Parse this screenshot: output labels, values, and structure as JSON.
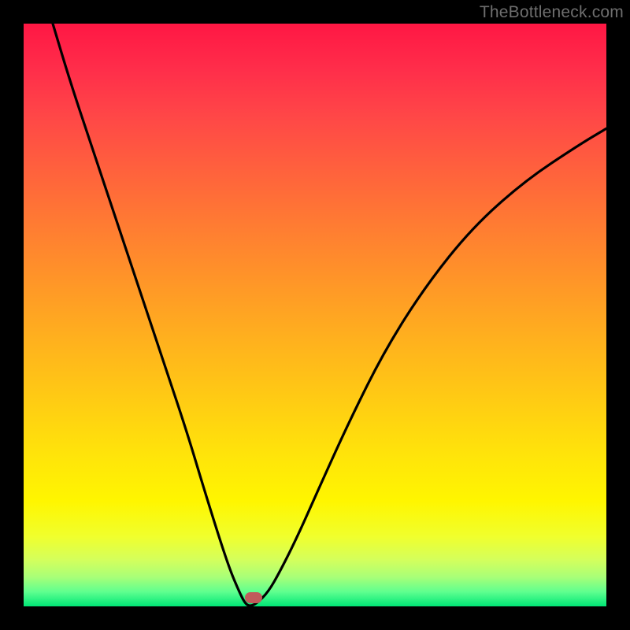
{
  "watermark": "TheBottleneck.com",
  "chart_data": {
    "type": "line",
    "title": "",
    "xlabel": "",
    "ylabel": "",
    "xlim": [
      0,
      100
    ],
    "ylim": [
      0,
      100
    ],
    "grid": false,
    "series": [
      {
        "name": "curve",
        "x": [
          5,
          8,
          12,
          16,
          20,
          24,
          28,
          31,
          33.5,
          35.5,
          37,
          38,
          38.8,
          40,
          42,
          44,
          47,
          51,
          56,
          62,
          69,
          77,
          86,
          95,
          100
        ],
        "y": [
          100,
          90,
          78,
          66,
          54,
          42,
          30,
          20,
          12,
          6,
          2.5,
          0.5,
          0,
          0.5,
          2.5,
          6,
          12,
          21,
          32,
          44,
          55,
          65,
          73,
          79,
          82
        ]
      }
    ],
    "marker": {
      "x": 39.5,
      "y": 1.5,
      "color": "#c15b5b"
    },
    "gradient_stops": [
      {
        "pct": 0,
        "color": "#ff1744"
      },
      {
        "pct": 50,
        "color": "#ffb000"
      },
      {
        "pct": 82,
        "color": "#fff600"
      },
      {
        "pct": 97,
        "color": "#5fff8f"
      },
      {
        "pct": 100,
        "color": "#00e676"
      }
    ]
  }
}
